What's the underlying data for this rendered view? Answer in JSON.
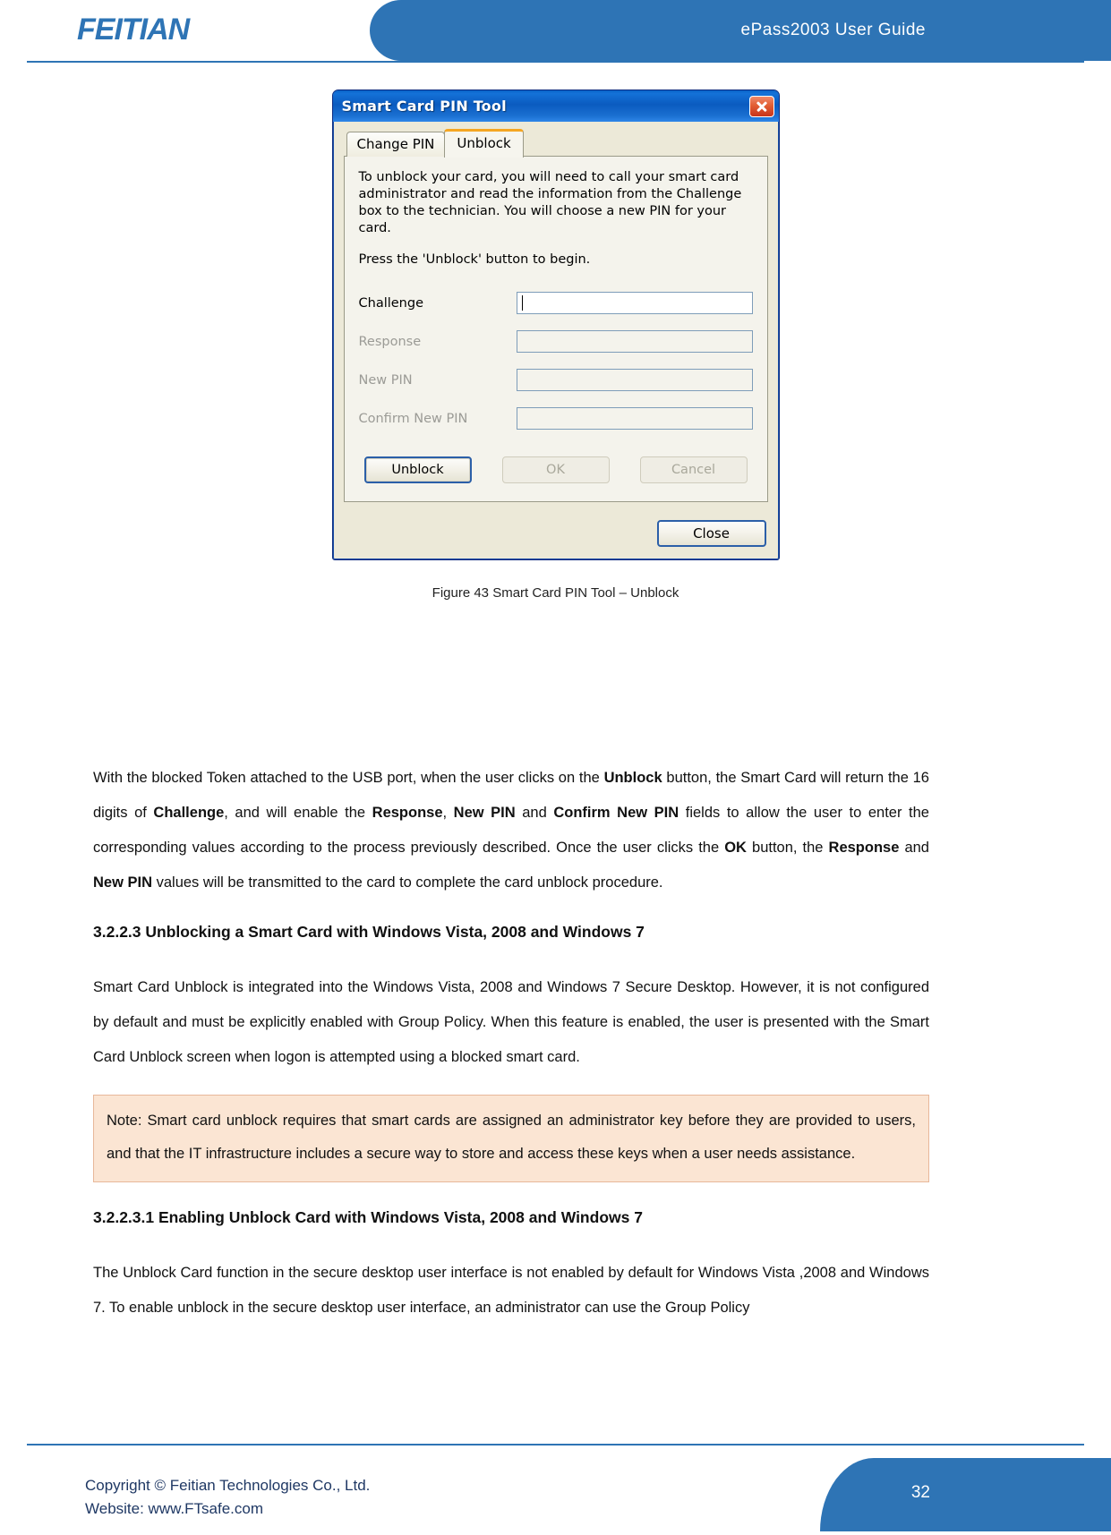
{
  "header": {
    "logo": "FEITIAN",
    "title": "ePass2003  User  Guide"
  },
  "dialog": {
    "title": "Smart Card PIN Tool",
    "close_icon": "close-icon",
    "tabs": [
      {
        "label": "Change PIN",
        "active": false
      },
      {
        "label": "Unblock",
        "active": true
      }
    ],
    "intro_text": "To unblock your card, you will need to call your smart card administrator and read the information from the Challenge box to the technician.  You will choose a new PIN for your card.",
    "instruction_text": "Press the 'Unblock' button to begin.",
    "fields": [
      {
        "label": "Challenge",
        "value": "",
        "enabled": true,
        "focused": true
      },
      {
        "label": "Response",
        "value": "",
        "enabled": false,
        "focused": false
      },
      {
        "label": "New PIN",
        "value": "",
        "enabled": false,
        "focused": false
      },
      {
        "label": "Confirm New PIN",
        "value": "",
        "enabled": false,
        "focused": false
      }
    ],
    "buttons": {
      "unblock": "Unblock",
      "ok": "OK",
      "cancel": "Cancel",
      "close": "Close"
    }
  },
  "figure": {
    "caption": "Figure 43 Smart Card PIN Tool – Unblock"
  },
  "content": {
    "paragraph_1_html": "With the blocked Token attached to the USB port, when the user clicks on the <b>Unblock</b> button, the Smart Card will return the 16 digits of <b>Challenge</b>, and will enable the <b>Response</b>, <b>New PIN</b> and <b>Confirm New PIN</b> fields to allow the user to enter the corresponding values according to the process previously described. Once the user clicks the <b>OK</b> button, the <b>Response</b> and <b>New PIN</b> values will be transmitted to the card to complete the card unblock procedure.",
    "heading_1": "3.2.2.3 Unblocking a Smart Card with Windows Vista, 2008 and Windows 7",
    "paragraph_2": "Smart Card Unblock is integrated into the Windows Vista, 2008 and Windows 7 Secure Desktop. However, it is not configured by default and must be explicitly enabled with Group Policy. When this feature is enabled, the user is presented with the Smart Card Unblock screen when logon is attempted using a blocked smart card.",
    "note": "Note: Smart card unblock requires that smart cards are assigned an administrator key before they are provided to users, and that the IT infrastructure includes a secure way to store and access these keys when a user needs assistance.",
    "heading_2": "3.2.2.3.1 Enabling Unblock Card with Windows Vista, 2008 and Windows 7",
    "paragraph_3": "The Unblock Card function in the secure desktop user interface is not enabled by default for Windows Vista ,2008 and Windows 7. To enable unblock in the secure desktop user interface, an administrator can use the Group Policy"
  },
  "footer": {
    "copyright": "Copyright © Feitian Technologies Co., Ltd.",
    "website": "Website: www.FTsafe.com",
    "page_number": "32"
  },
  "colors": {
    "brand_blue": "#2E74B5",
    "note_bg": "#FBE5D3",
    "dialog_face": "#ECE9D8"
  }
}
